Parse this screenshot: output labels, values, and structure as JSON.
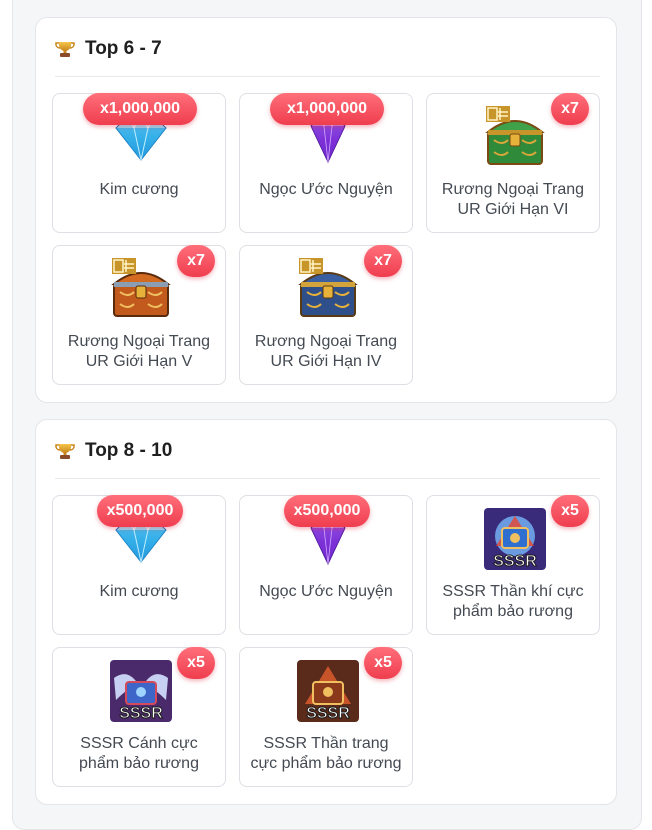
{
  "sections": [
    {
      "title": "Top 6 - 7",
      "icon": "trophy-icon",
      "items": [
        {
          "name": "Kim cương",
          "qty": "x1,000,000",
          "icon": "diamond-icon"
        },
        {
          "name": "Ngọc Ước Nguyện",
          "qty": "x1,000,000",
          "icon": "wish-gem-icon"
        },
        {
          "name": "Rương Ngoại Trang UR Giới Hạn VI",
          "qty": "x7",
          "icon": "green-chest-icon"
        },
        {
          "name": "Rương Ngoại Trang UR Giới Hạn V",
          "qty": "x7",
          "icon": "orange-chest-icon"
        },
        {
          "name": "Rương Ngoại Trang UR Giới Hạn IV",
          "qty": "x7",
          "icon": "blue-chest-icon"
        }
      ]
    },
    {
      "title": "Top 8 - 10",
      "icon": "trophy-icon",
      "items": [
        {
          "name": "Kim cương",
          "qty": "x500,000",
          "icon": "diamond-icon"
        },
        {
          "name": "Ngọc Ước Nguyện",
          "qty": "x500,000",
          "icon": "wish-gem-icon"
        },
        {
          "name": "SSSR Thần khí cực phẩm bảo rương",
          "qty": "x5",
          "icon": "sssr-artifact-chest-icon",
          "img_text": "SSSR"
        },
        {
          "name": "SSSR Cánh cực phẩm bảo rương",
          "qty": "x5",
          "icon": "sssr-wing-chest-icon",
          "img_text": "SSSR"
        },
        {
          "name": "SSSR Thần trang cực phẩm bảo rương",
          "qty": "x5",
          "icon": "sssr-costume-chest-icon",
          "img_text": "SSSR"
        }
      ]
    }
  ],
  "colors": {
    "badge": "#ef3d4e",
    "card_border": "#dcdfe4",
    "page_bg": "#f5f6f8"
  }
}
